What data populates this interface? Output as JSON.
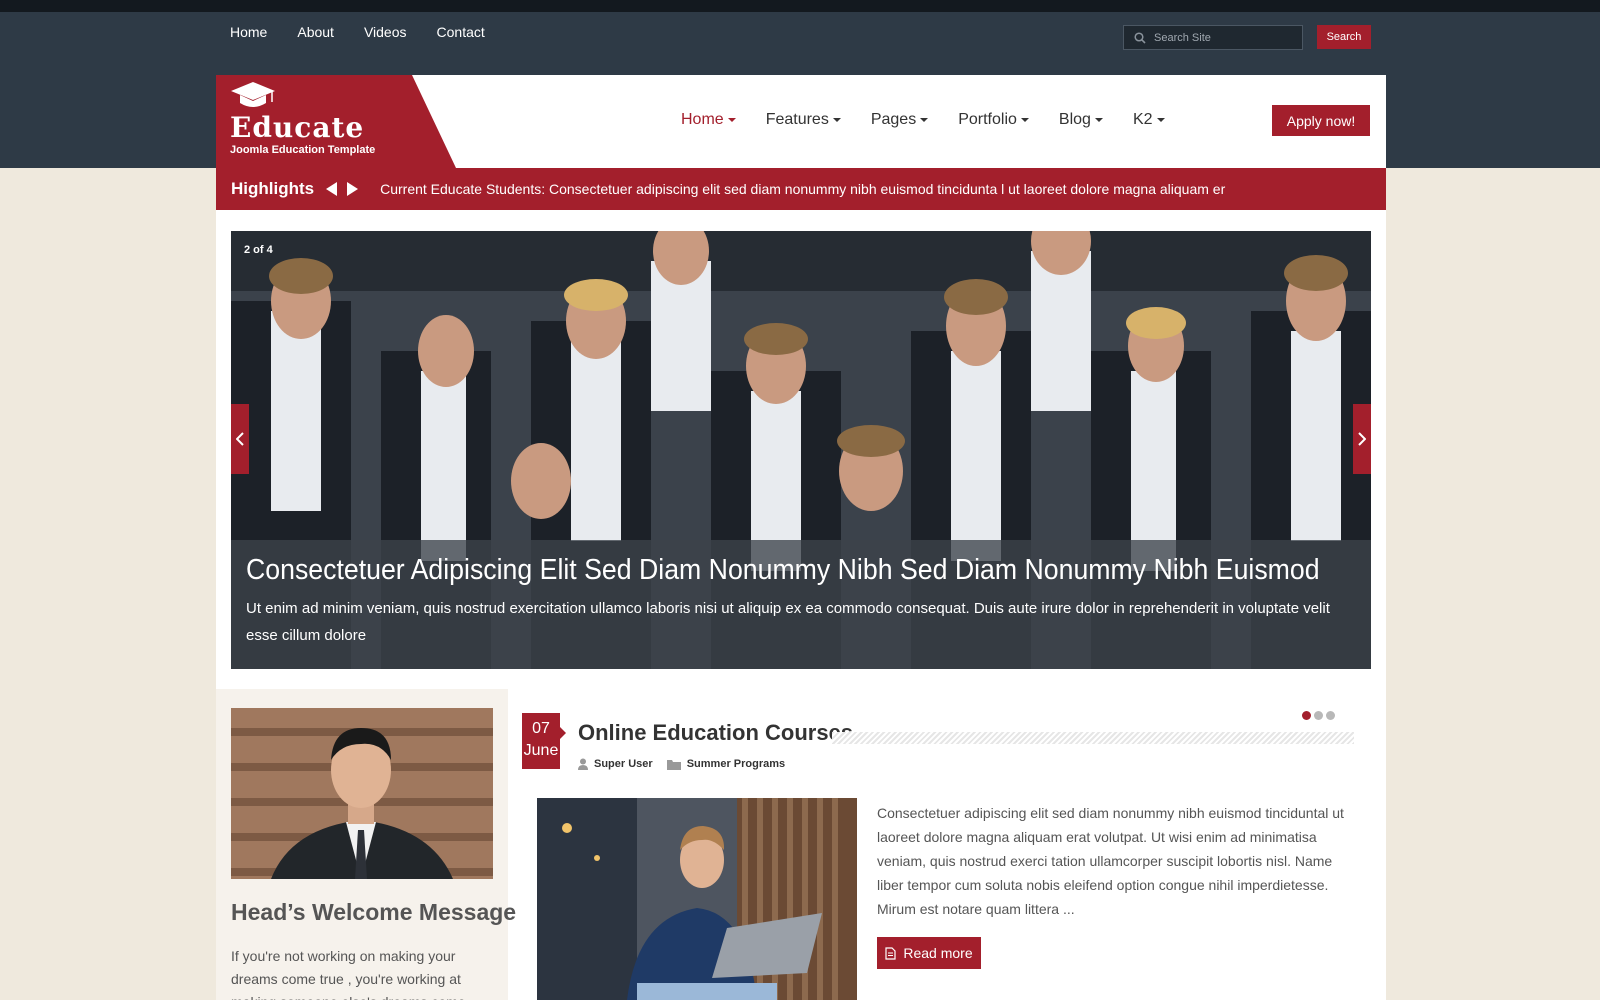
{
  "top_nav": [
    "Home",
    "About",
    "Videos",
    "Contact"
  ],
  "search": {
    "placeholder": "Search Site",
    "button": "Search"
  },
  "logo": {
    "name": "Educate",
    "tagline": "Joomla Education Template"
  },
  "main_nav": [
    {
      "label": "Home",
      "active": true
    },
    {
      "label": "Features",
      "active": false
    },
    {
      "label": "Pages",
      "active": false
    },
    {
      "label": "Portfolio",
      "active": false
    },
    {
      "label": "Blog",
      "active": false
    },
    {
      "label": "K2",
      "active": false
    }
  ],
  "apply_button": "Apply now!",
  "highlights": {
    "label": "Highlights",
    "text": "Current Educate Students: Consectetuer adipiscing elit sed diam nonummy nibh euismod tincidunta l ut laoreet dolore magna aliquam er"
  },
  "slider": {
    "counter": "2 of 4",
    "title": "Consectetuer Adipiscing Elit Sed Diam Nonummy Nibh Sed Diam Nonummy Nibh Euismod",
    "text": "Ut enim ad minim veniam, quis nostrud exercitation ullamco laboris nisi ut aliquip ex ea commodo consequat. Duis aute irure dolor in reprehenderit in voluptate velit esse cillum dolore"
  },
  "sidebar": {
    "heading": "Head’s Welcome Message",
    "text": "If you're not working on making your dreams come true , you're working at making someone else's dreams come"
  },
  "article": {
    "day": "07",
    "month": "June",
    "title": "Online Education Courses",
    "author": "Super User",
    "category": "Summer Programs",
    "text": "Consectetuer adipiscing elit sed diam nonummy nibh euismod tinciduntal ut laoreet dolore magna aliquam erat volutpat. Ut wisi enim ad minimatisa veniam, quis nostrud exerci tation ullamcorper suscipit lobortis nisl. Name liber tempor cum soluta nobis eleifend option congue nihil imperdietesse. Mirum est notare quam littera ...",
    "read_more": "Read more"
  },
  "colors": {
    "accent": "#a31f2c",
    "header": "#2e3a46",
    "page_bg": "#efe9dd"
  }
}
